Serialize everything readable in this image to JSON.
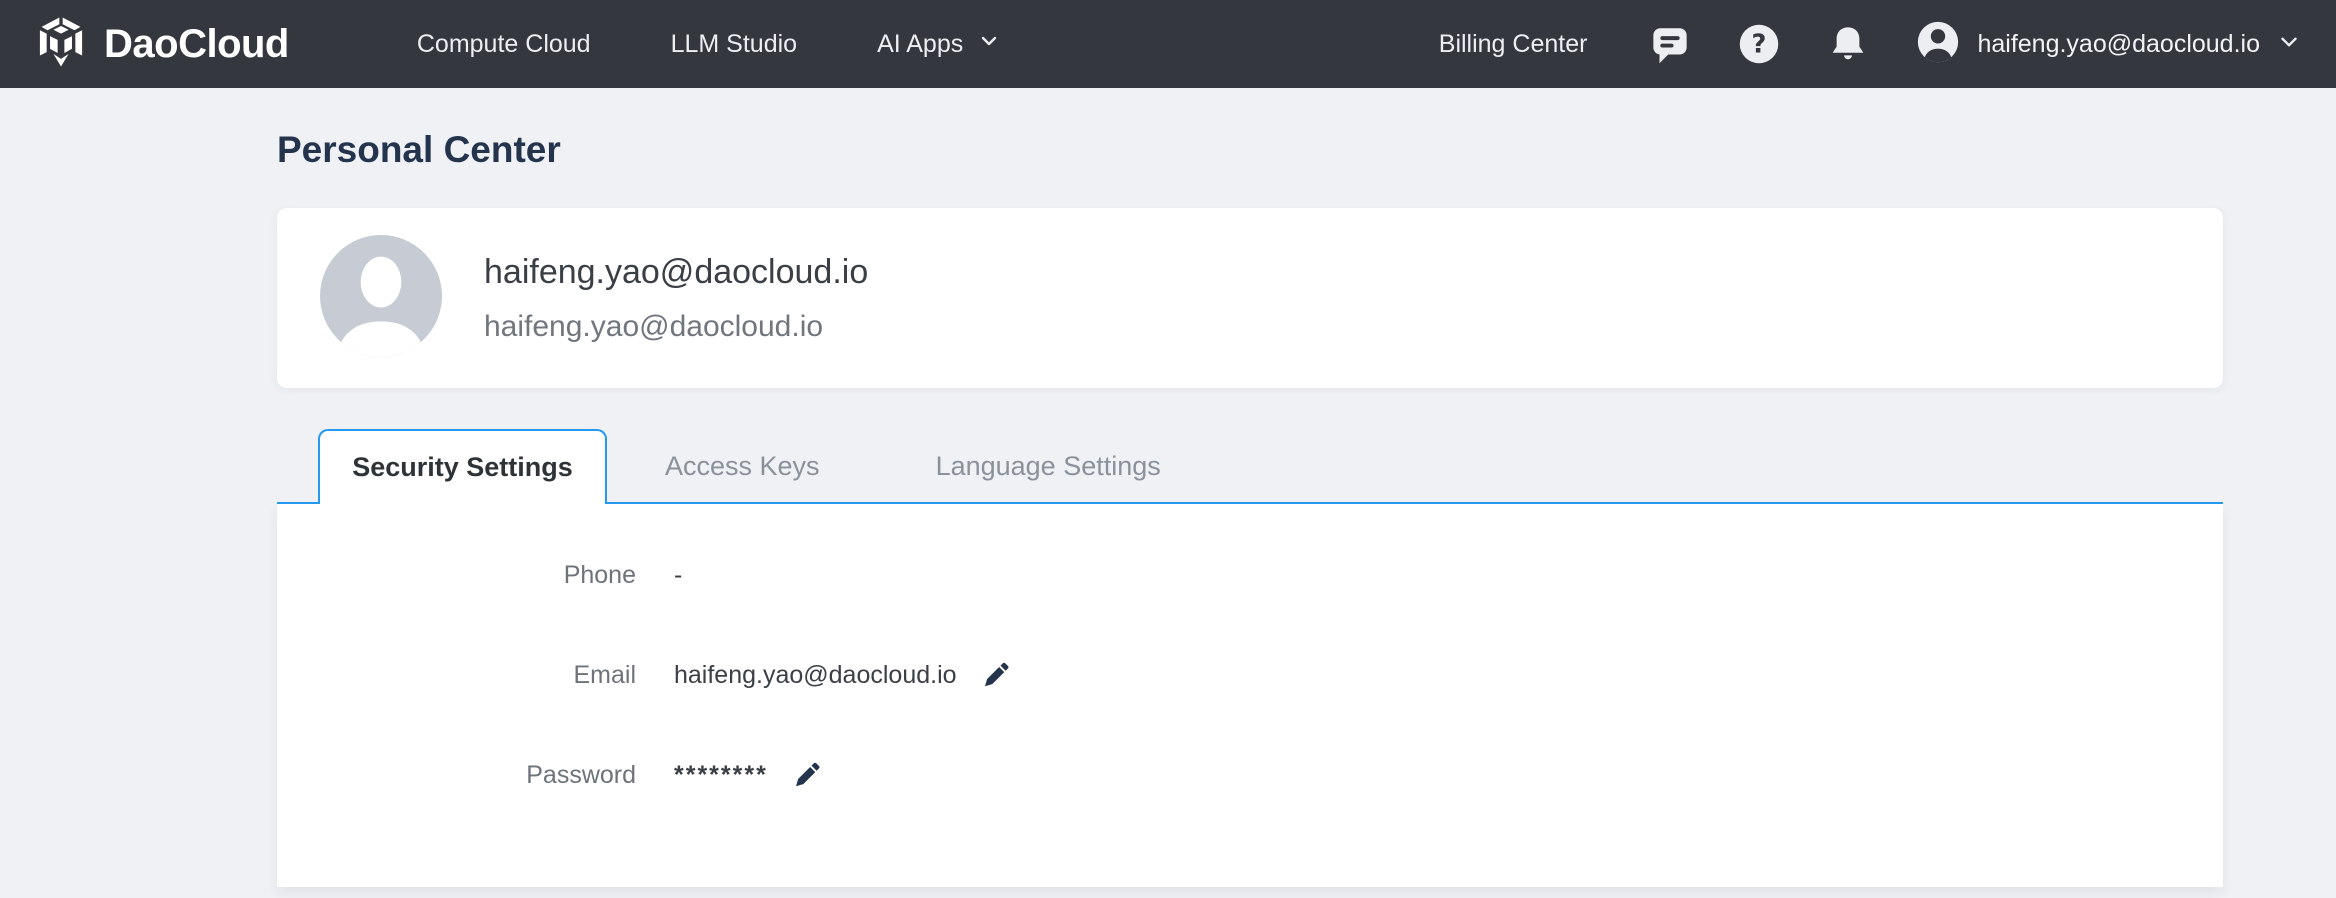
{
  "topbar": {
    "brand": "DaoCloud",
    "nav": [
      {
        "label": "Compute Cloud"
      },
      {
        "label": "LLM Studio"
      },
      {
        "label": "AI Apps",
        "has_dropdown": true
      }
    ],
    "billing_label": "Billing Center",
    "account_email": "haifeng.yao@daocloud.io"
  },
  "page": {
    "title": "Personal Center"
  },
  "profile_card": {
    "display_name": "haifeng.yao@daocloud.io",
    "email": "haifeng.yao@daocloud.io"
  },
  "tabs": [
    {
      "label": "Security Settings",
      "active": true
    },
    {
      "label": "Access Keys",
      "active": false
    },
    {
      "label": "Language Settings",
      "active": false
    }
  ],
  "security_form": {
    "rows": [
      {
        "label": "Phone",
        "value": "-",
        "editable": false
      },
      {
        "label": "Email",
        "value": "haifeng.yao@daocloud.io",
        "editable": true
      },
      {
        "label": "Password",
        "value": "********",
        "editable": true
      }
    ]
  },
  "colors": {
    "accent_blue": "#2598f0",
    "topbar_bg": "#35373e",
    "page_bg": "#eff1f5",
    "heading": "#24344d",
    "avatar_gray": "#c6cbd4"
  }
}
